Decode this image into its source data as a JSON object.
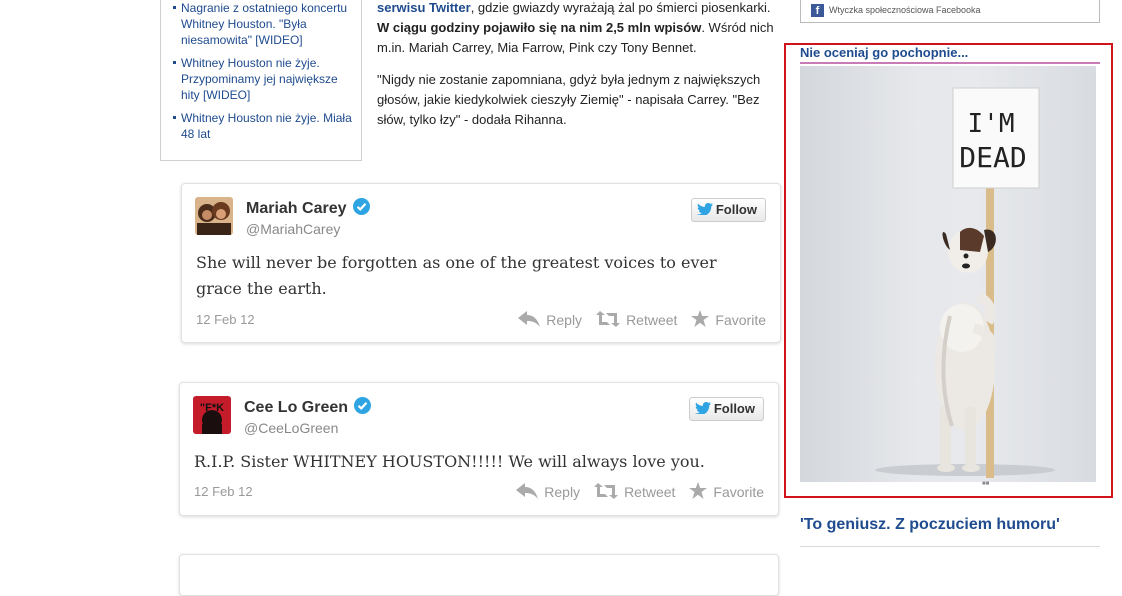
{
  "related_links": [
    "Nagranie z ostatniego koncertu Whitney Houston. \"Była niesamowita\" [WIDEO]",
    "Whitney Houston nie żyje. Przypominamy jej największe hity [WIDEO]",
    "Whitney Houston nie żyje. Miała 48 lat"
  ],
  "article": {
    "p1_link": "serwisu Twitter",
    "p1_text1": ", gdzie gwiazdy wyrażają żal po śmierci piosenkarki. ",
    "p1_bold": "W ciągu godziny pojawiło się na nim 2,5 mln wpisów",
    "p1_text2": ". Wśród nich m.in. Mariah Carrey, Mia Farrow, Pink czy Tony Bennet.",
    "p2": "\"Nigdy nie zostanie zapomniana, gdyż była jednym z największych głosów, jakie kiedykolwiek cieszyły Ziemię\" - napisała Carrey. \"Bez słów, tylko łzy\" - dodała Rihanna."
  },
  "tweets": [
    {
      "name": "Mariah Carey",
      "handle": "@MariahCarey",
      "text": "She will never be forgotten as one of the greatest voices to ever grace the earth.",
      "date": "12 Feb 12"
    },
    {
      "name": "Cee Lo Green",
      "handle": "@CeeLoGreen",
      "text": "R.I.P. Sister WHITNEY HOUSTON!!!!! We will always love you.",
      "date": "12 Feb 12"
    },
    {
      "name": "",
      "handle": "",
      "text": "",
      "date": ""
    }
  ],
  "tweet_actions": {
    "follow": "Follow",
    "reply": "Reply",
    "retweet": "Retweet",
    "favorite": "Favorite"
  },
  "sidebar": {
    "fb_plugin_label": "Wtyczka społecznościowa Facebooka",
    "promo_title": "Nie oceniaj go pochopnie...",
    "sign_line1": "I'M",
    "sign_line2": "DEAD",
    "promo_caption": "■■",
    "next_title": "'To geniusz. Z poczuciem humoru'"
  },
  "colors": {
    "link_blue": "#1f4b8f",
    "highlight_red": "#d0141c",
    "twitter_blue": "#2ea4e3"
  }
}
